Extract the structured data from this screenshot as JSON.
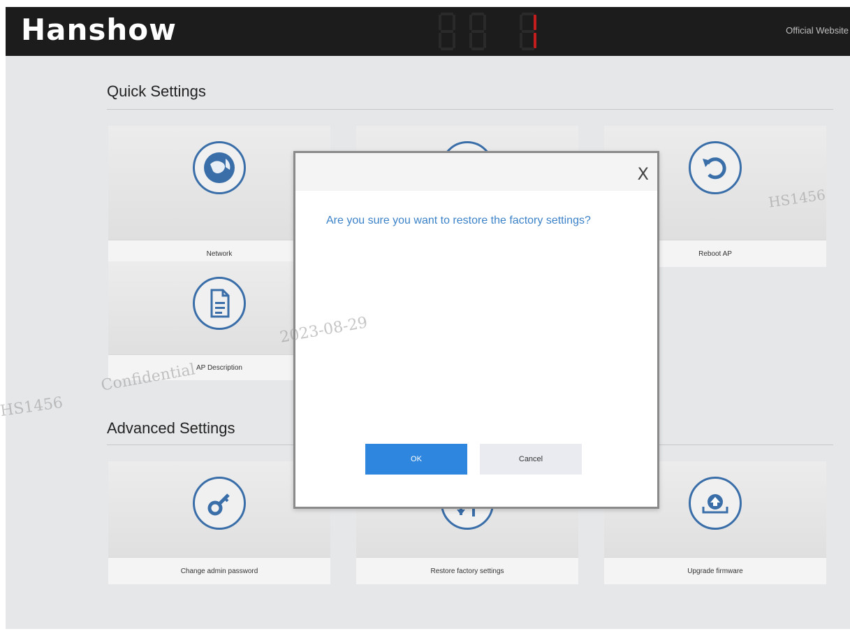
{
  "header": {
    "logo": "Hanshow",
    "official_link": "Official Website"
  },
  "quick_settings": {
    "title": "Quick Settings",
    "cards": [
      {
        "label": "Network",
        "icon": "globe-icon"
      },
      {
        "label": "",
        "icon": "hidden-icon"
      },
      {
        "label": "Reboot AP",
        "icon": "reboot-icon"
      },
      {
        "label": "AP Description",
        "icon": "document-icon"
      }
    ]
  },
  "advanced_settings": {
    "title": "Advanced Settings",
    "cards": [
      {
        "label": "Change admin password",
        "icon": "key-icon"
      },
      {
        "label": "Restore factory settings",
        "icon": "restore-icon"
      },
      {
        "label": "Upgrade firmware",
        "icon": "upload-icon"
      }
    ]
  },
  "dialog": {
    "close_label": "X",
    "message": "Are you sure you want to restore the factory settings?",
    "ok_label": "OK",
    "cancel_label": "Cancel"
  },
  "watermarks": [
    "HS1456",
    "Confidential",
    "2023-08-29",
    "HS1456"
  ],
  "colors": {
    "header_bg": "#1c1c1c",
    "accent_blue": "#2f86de",
    "icon_blue": "#3a6ea9",
    "message_blue": "#3b82c9",
    "led_red": "#c41d1d"
  }
}
